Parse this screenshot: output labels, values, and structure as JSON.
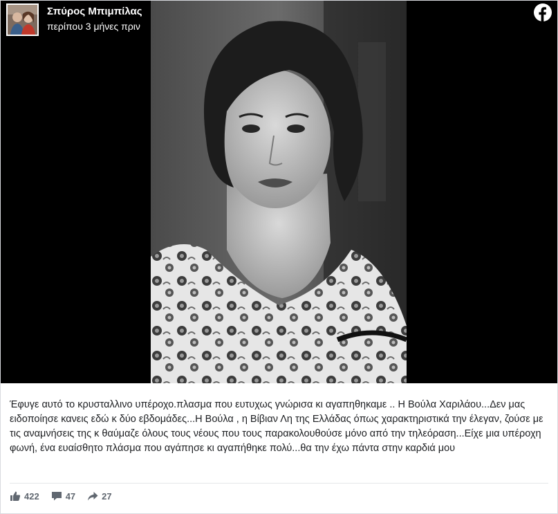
{
  "header": {
    "author_name": "Σπύρος Μπιμπίλας",
    "post_time": "περίπου 3 μήνες πριν"
  },
  "icons": {
    "brand": "facebook-logo-icon",
    "like": "thumbs-up-icon",
    "comment": "comment-bubble-icon",
    "share": "share-arrow-icon"
  },
  "colors": {
    "media_background": "#000000",
    "header_text": "#ffffff",
    "caption_text": "#1c1e21",
    "stat_text": "#606770"
  },
  "post": {
    "caption": "Έφυγε αυτό το κρυσταλλινο υπέροχο.πλασμα που ευτυχως γνώρισα κι αγαπηθηκαμε .. Η Βούλα Χαριλάου...Δεν μας ειδοποίησε κανεις εδώ κ δύο εβδομάδες...Η Βούλα , η Βίβιαν Λη της Ελλάδας όπως χαρακτηριστικά την έλεγαν, ζούσε με τις αναμνήσεις της κ θαύμαζε όλους τους νέους που τους παρακολουθούσε μόνο από την τηλεόραση...Είχε μια υπέροχη φωνή, ένα ευαίσθητο πλάσμα που αγάπησε κι αγαπήθηκε πολύ...θα την έχω πάντα στην καρδιά μου"
  },
  "stats": {
    "likes": "422",
    "comments": "47",
    "shares": "27"
  }
}
